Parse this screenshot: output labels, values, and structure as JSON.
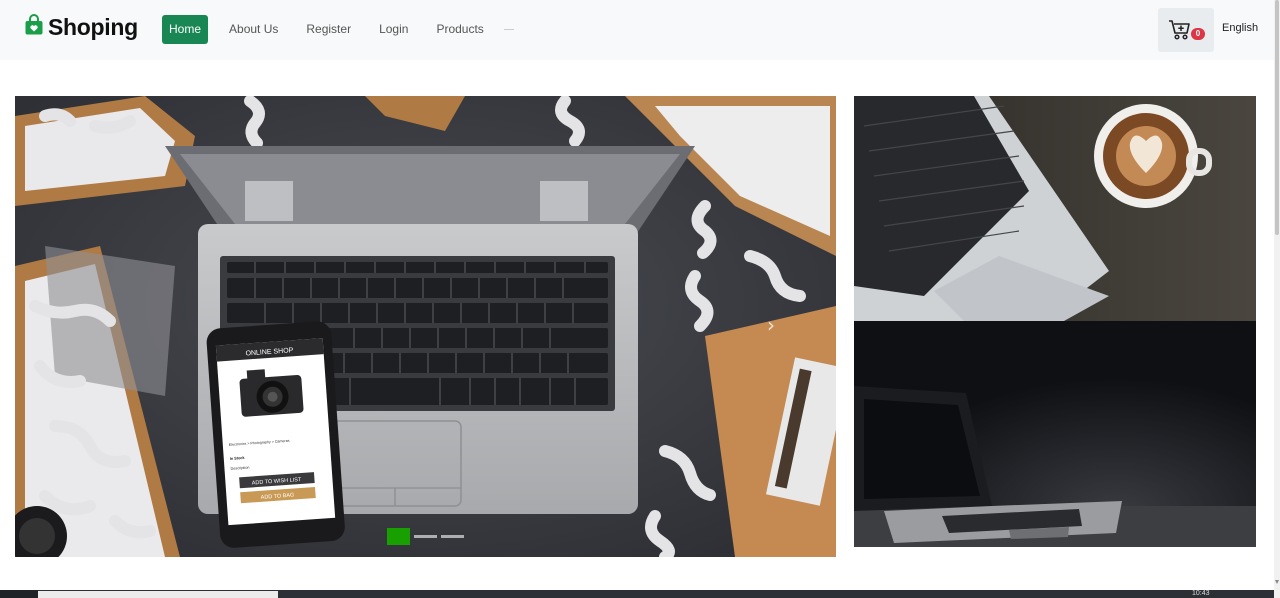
{
  "brand": {
    "name": "Shoping",
    "icon": "shopping-bag-icon",
    "color": "#1a9e4a"
  },
  "nav": {
    "items": [
      {
        "label": "Home",
        "active": true
      },
      {
        "label": "About Us",
        "active": false
      },
      {
        "label": "Register",
        "active": false
      },
      {
        "label": "Login",
        "active": false
      },
      {
        "label": "Products",
        "active": false
      }
    ],
    "active_color": "#198754"
  },
  "cart": {
    "icon": "cart-icon",
    "count": "0",
    "badge_color": "#dc3545"
  },
  "language": {
    "label": "English"
  },
  "carousel": {
    "slide_count": 3,
    "active_index": 0,
    "indicator_active_color": "#18a000",
    "next_icon": "chevron-right-icon",
    "phone_screen": {
      "header": "ONLINE SHOP",
      "breadcrumb": "Electronics > Photography > Cameras",
      "stock": "In Stock",
      "description": "Description",
      "wishlist_button": "ADD TO WISH LIST",
      "bag_button": "ADD TO BAG"
    }
  },
  "side_images": [
    {
      "name": "laptop-and-coffee-image"
    },
    {
      "name": "laptop-in-dark-image"
    }
  ],
  "taskbar": {
    "clock": "10:43"
  }
}
